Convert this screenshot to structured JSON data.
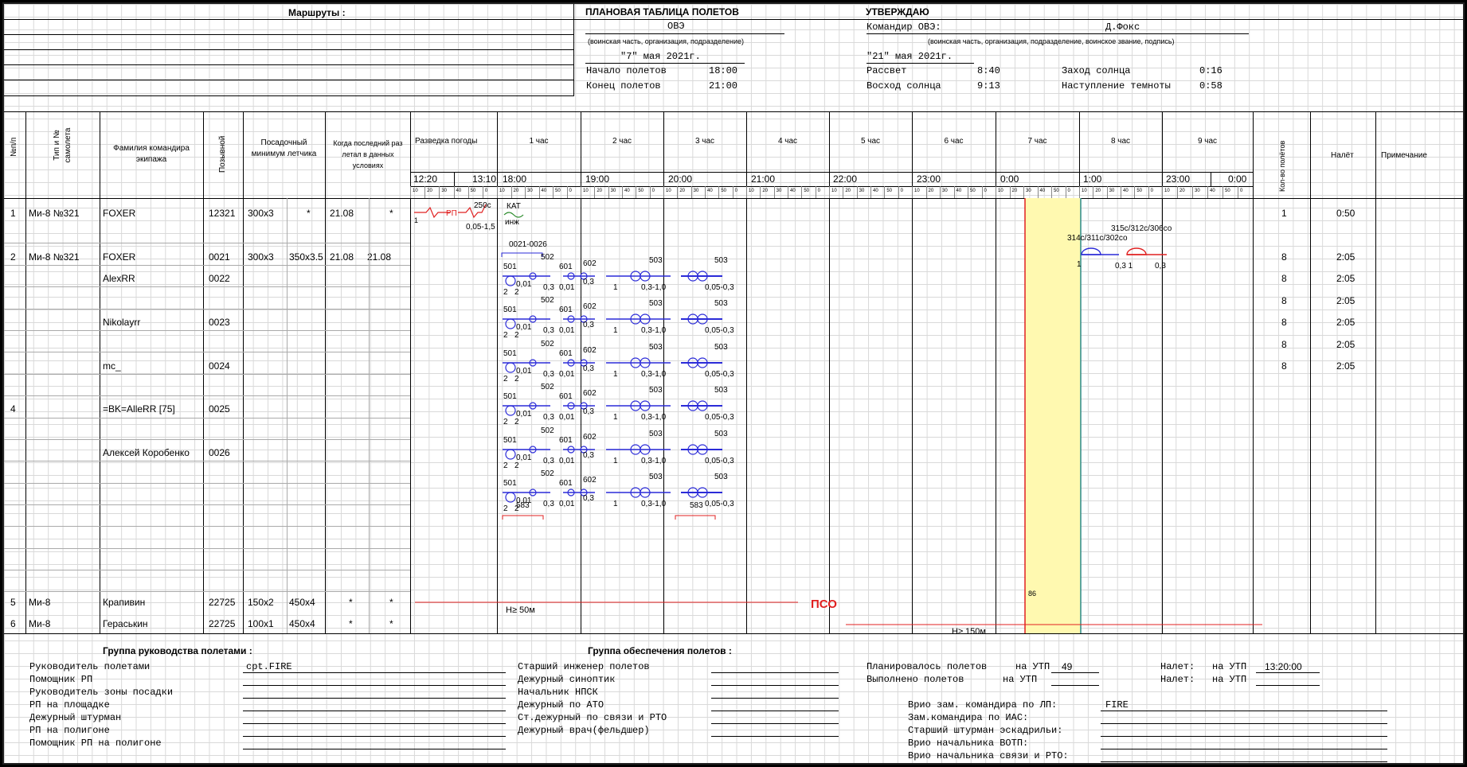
{
  "routes_label": "Маршруты :",
  "plan": {
    "title": "ПЛАНОВАЯ ТАБЛИЦА ПОЛЕТОВ",
    "unit": "ОВЭ",
    "unit_caption": "(воинская часть, организация, подразделение)",
    "date": "\"7\" мая 2021г.",
    "start_label": "Начало полетов",
    "start_value": "18:00",
    "end_label": "Конец полетов",
    "end_value": "21:00"
  },
  "approve": {
    "title": "УТВЕРЖДАЮ",
    "commander_label": "Командир ОВЭ:",
    "commander_name": "Д.Фокс",
    "caption": "(воинская часть, организация, подразделение, воинское звание, подпись)",
    "date": "\"21\" мая 2021г.",
    "dawn_label": "Рассвет",
    "dawn_value": "8:40",
    "sunrise_label": "Восход солнца",
    "sunrise_value": "9:13",
    "sunset_label": "Заход солнца",
    "sunset_value": "0:16",
    "dark_label": "Наступление темноты",
    "dark_value": "0:58"
  },
  "headers": {
    "num": "№п/п",
    "type": "Тип и № самолета",
    "crew": "Фамилия командира экипажа",
    "callsign": "Позывной",
    "minimum": "Посадочный минимум летчика",
    "last_flight": "Когда последний раз летал в данных условиях",
    "weather": "Разведка погоды",
    "hours": [
      "1 час",
      "2 час",
      "3 час",
      "4 час",
      "5 час",
      "6 час",
      "7 час",
      "8 час",
      "9 час"
    ],
    "flights_count": "Кол-во полётов",
    "flight_time": "Налёт",
    "note": "Примечание",
    "times": [
      "12:20",
      "13:10",
      "18:00",
      "19:00",
      "20:00",
      "21:00",
      "22:00",
      "23:00",
      "0:00",
      "1:00",
      "23:00",
      "0:00"
    ],
    "minutes": [
      "10",
      "20",
      "30",
      "40",
      "50",
      "0"
    ]
  },
  "rows": [
    {
      "num": "1",
      "type": "Ми-8 №321",
      "name": "FOXER",
      "call": "12321",
      "min1": "300x3",
      "min2": "*",
      "last1": "21.08",
      "last2": "*",
      "count": "1",
      "time": "0:50"
    },
    {
      "num": "2",
      "type": "Ми-8 №321",
      "name": "FOXER",
      "call": "0021",
      "min1": "300x3",
      "min2": "350x3.5",
      "last1": "21.08",
      "last2": "21.08",
      "count": "8",
      "time": "2:05"
    },
    {
      "num": "",
      "type": "",
      "name": "AlexRR",
      "call": "0022",
      "min1": "",
      "min2": "",
      "last1": "",
      "last2": "",
      "count": "8",
      "time": "2:05"
    },
    {
      "num": "",
      "type": "",
      "name": "",
      "call": "",
      "min1": "",
      "min2": "",
      "last1": "",
      "last2": "",
      "count": "8",
      "time": "2:05"
    },
    {
      "num": "",
      "type": "",
      "name": "Nikolayrr",
      "call": "0023",
      "min1": "",
      "min2": "",
      "last1": "",
      "last2": "",
      "count": "8",
      "time": "2:05"
    },
    {
      "num": "",
      "type": "",
      "name": "",
      "call": "",
      "min1": "",
      "min2": "",
      "last1": "",
      "last2": "",
      "count": "8",
      "time": "2:05"
    },
    {
      "num": "",
      "type": "",
      "name": "mc_",
      "call": "0024",
      "min1": "",
      "min2": "",
      "last1": "",
      "last2": "",
      "count": "8",
      "time": "2:05"
    },
    {
      "num": "4",
      "type": "",
      "name": "=BK=AlleRR [75]",
      "call": "0025",
      "min1": "",
      "min2": "",
      "last1": "",
      "last2": "",
      "count": "",
      "time": ""
    },
    {
      "num": "",
      "type": "",
      "name": "Алексей Коробенко",
      "call": "0026",
      "min1": "",
      "min2": "",
      "last1": "",
      "last2": "",
      "count": "",
      "time": ""
    }
  ],
  "bottom_rows": [
    {
      "num": "5",
      "type": "Ми-8",
      "name": "Крапивин",
      "call": "22725",
      "min1": "150x2",
      "min2": "450x4",
      "last1": "*",
      "last2": "*"
    },
    {
      "num": "6",
      "type": "Ми-8",
      "name": "Гераськин",
      "call": "22725",
      "min1": "100x1",
      "min2": "450x4",
      "last1": "*",
      "last2": "*"
    }
  ],
  "plot_labels": {
    "rp": "РП",
    "t250": "250с",
    "kat": "КАТ",
    "inzh": "инж",
    "v05": "0,05-1,5",
    "one": "1",
    "r0021": "0021-0026",
    "c501": "501",
    "c502": "502",
    "c601": "601",
    "c602": "602",
    "c503": "503",
    "v001": "0,01",
    "v03": "0,3",
    "v2": "2",
    "v0310": "0,3-1,0",
    "v0503": "0,05-0,3",
    "c583": "583",
    "h50": "H≥ 50м",
    "pso": "ПСО",
    "h150": "H≥ 150м",
    "c86": "86",
    "c314": "314с/311с/302со",
    "c315": "315с/312с/306со",
    "v031": "0,3 1",
    "v03b": "0,3"
  },
  "footer": {
    "left_title": "Группа руководства полетами :",
    "left_items": [
      "Руководитель полетами",
      "Помощник РП",
      "Руководитель зоны посадки",
      "РП на площадке",
      "Дежурный штурман",
      "РП на полигоне",
      "Помощник РП на полигоне"
    ],
    "rp_value": "cpt.FIRE",
    "mid_title": "Группа обеспечения полетов :",
    "mid_items": [
      "Старший инженер полетов",
      "Дежурный синоптик",
      "Начальник НПСК",
      "Дежурный по АТО",
      "Ст.дежурный по связи и РТО",
      "Дежурный врач(фельдшер)"
    ],
    "planned_label": "Планировалось полетов",
    "planned_on": "на УТП",
    "planned_value": "49",
    "done_label": "Выполнено полетов",
    "done_on": "на УТП",
    "nalet_label1": "Налет:",
    "nalet_on1": "на УТП",
    "nalet_value1": "13:20:00",
    "nalet_label2": "Налет:",
    "nalet_on2": "на УТП",
    "right_items": [
      "Врио зам. командира по ЛП:",
      "Зам.командира по ИАС:",
      "Старший штурман эскадрильи:",
      "Врио начальника ВОТП:",
      "Врио начальника связи и РТО:"
    ],
    "right_first_value": "FIRE"
  },
  "colors": {
    "blue": "#2b2bd8",
    "red": "#e02020",
    "yellow": "#fff9b0"
  }
}
